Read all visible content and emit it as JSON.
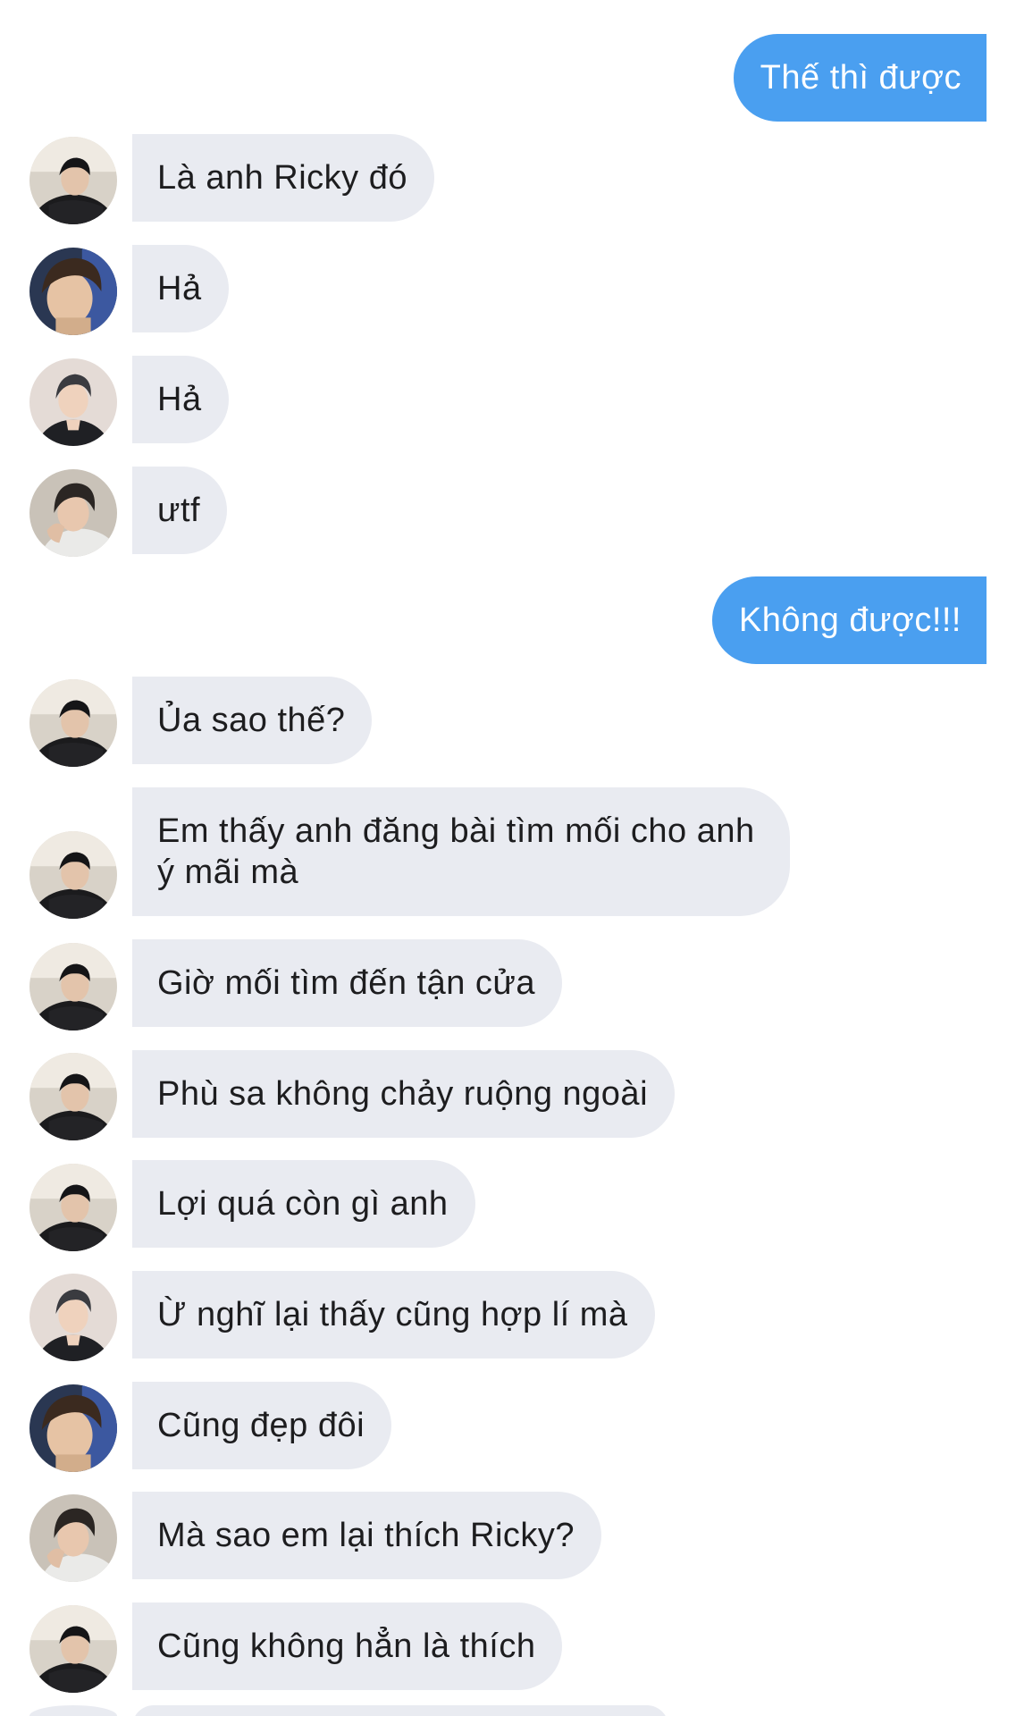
{
  "messages": [
    {
      "dir": "out",
      "text": "Thế thì được"
    },
    {
      "dir": "in",
      "avatar": "avatar-a",
      "text": "Là anh Ricky đó"
    },
    {
      "dir": "in",
      "avatar": "avatar-b",
      "text": "Hả"
    },
    {
      "dir": "in",
      "avatar": "avatar-c",
      "text": "Hả"
    },
    {
      "dir": "in",
      "avatar": "avatar-d",
      "text": "ưtf"
    },
    {
      "dir": "out",
      "text": "Không được!!!"
    },
    {
      "dir": "in",
      "avatar": "avatar-a",
      "text": "Ủa sao thế?"
    },
    {
      "dir": "in",
      "avatar": "avatar-a",
      "text": "Em thấy anh đăng bài tìm mối cho anh ý mãi mà"
    },
    {
      "dir": "in",
      "avatar": "avatar-a",
      "text": "Giờ mối tìm đến tận cửa"
    },
    {
      "dir": "in",
      "avatar": "avatar-a",
      "text": "Phù sa không chảy ruộng ngoài"
    },
    {
      "dir": "in",
      "avatar": "avatar-a",
      "text": "Lợi quá còn gì anh"
    },
    {
      "dir": "in",
      "avatar": "avatar-c",
      "text": "Ừ nghĩ lại thấy cũng hợp lí mà"
    },
    {
      "dir": "in",
      "avatar": "avatar-b",
      "text": "Cũng đẹp đôi"
    },
    {
      "dir": "in",
      "avatar": "avatar-d",
      "text": "Mà sao em lại thích Ricky?"
    },
    {
      "dir": "in",
      "avatar": "avatar-a",
      "text": "Cũng không hẳn là thích"
    }
  ],
  "colors": {
    "incoming_bubble": "#e9ebf1",
    "outgoing_bubble": "#4a9ff0",
    "incoming_text": "#1d1d1f",
    "outgoing_text": "#ffffff"
  }
}
